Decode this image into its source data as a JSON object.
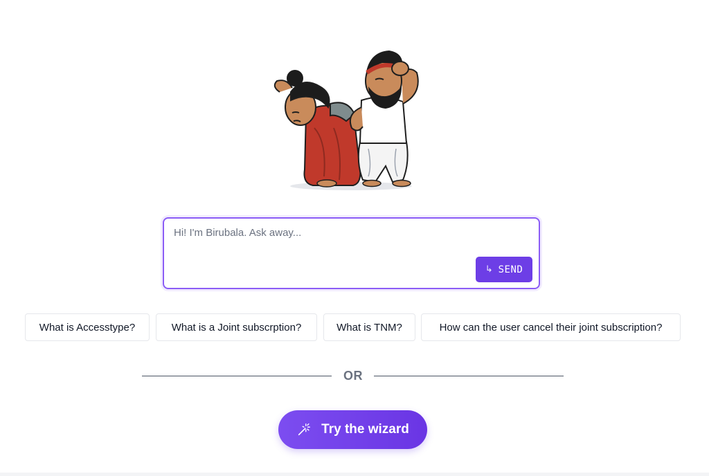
{
  "chat": {
    "placeholder": "Hi! I'm Birubala. Ask away...",
    "send_label": "SEND",
    "send_icon": "return-arrow-icon"
  },
  "suggestions": [
    "What is Accesstype?",
    "What is a Joint subscrption?",
    "What is TNM?",
    "How can the user cancel their joint subscription?"
  ],
  "divider": {
    "label": "OR"
  },
  "wizard": {
    "label": "Try the wizard",
    "icon": "magic-wand-icon"
  },
  "colors": {
    "accent": "#6d3ee6",
    "border_accent": "#8b5cf6",
    "chip_border": "#e5e7eb",
    "divider_text": "#6b7280"
  }
}
